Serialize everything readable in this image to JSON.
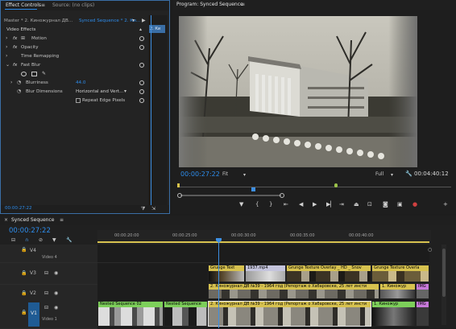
{
  "effect_controls": {
    "tabs": [
      "Effect Controls",
      "Source: (no clips)"
    ],
    "master_label": "Master * 2. Киножурнал ДВ...",
    "sequence_label": "Synced Sequence * 2. Ки...",
    "mini_clip_label": "2. Ки",
    "section": "Video Effects",
    "effects": [
      {
        "fx": "fx",
        "name": "Motion"
      },
      {
        "fx": "fx",
        "name": "Opacity"
      },
      {
        "fx": "",
        "name": "Time Remapping"
      },
      {
        "fx": "fx",
        "name": "Fast Blur"
      }
    ],
    "blurriness_label": "Blurriness",
    "blurriness_value": "44.0",
    "blur_dimensions_label": "Blur Dimensions",
    "blur_dimensions_value": "Horizontal and Vert...",
    "repeat_edge_label": "Repeat Edge Pixels",
    "timecode": "00:00:27:22"
  },
  "program_monitor": {
    "title": "Program: Synced Sequence",
    "timecode": "00:00:27:22",
    "fit": "Fit",
    "quality": "Full",
    "duration": "00:04:40:12"
  },
  "timeline": {
    "tab": "Synced Sequence",
    "timecode": "00:00:27:22",
    "ruler_labels": [
      "00:00:20:00",
      "00:00:25:00",
      "00:00:30:00",
      "00:00:35:00",
      "00:00:40:00"
    ],
    "tracks": [
      {
        "id": "V4",
        "name": "Video 4"
      },
      {
        "id": "V3",
        "name": ""
      },
      {
        "id": "V2",
        "name": ""
      },
      {
        "id": "V1",
        "name": "Video 1"
      }
    ],
    "clips_v3": [
      "Grunge Text",
      "1937.mp4",
      "Grunge Texture Overlay _ HD _ Snov",
      "Grunge Texture Overla"
    ],
    "clips_v2": [
      "2. Киножурнал ДВ №39 - 1964 год (Репортаж о Хабаровске, 25 лет инсти",
      "1. Киножур",
      "IMG"
    ],
    "clips_v1": [
      "Nested Sequence 02",
      "Nested Sequence",
      "2. Киножурнал ДВ №39 - 1964 год (Репортаж о Хабаровске, 25 лет инсти",
      "1. Киножур",
      "IMG"
    ]
  },
  "colors": {
    "accent": "#2d8ceb",
    "playhead": "#3d8fe3",
    "clip_yellow": "#d7c24f",
    "clip_green": "#7dcf5a",
    "clip_purple": "#c779d9"
  }
}
